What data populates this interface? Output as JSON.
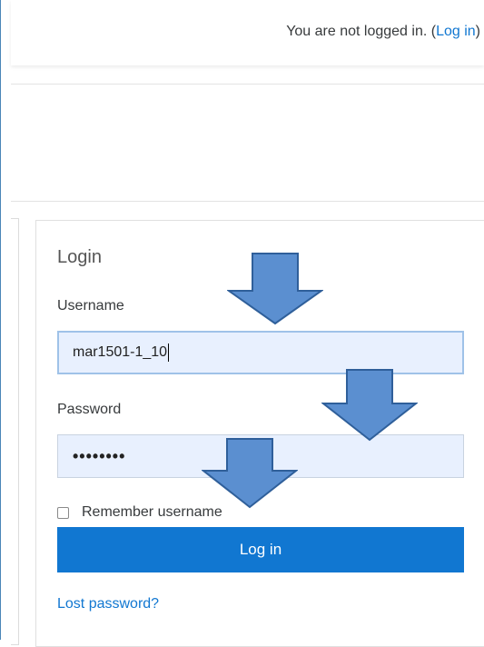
{
  "topbar": {
    "status_prefix": "You are not logged in. (",
    "login_link": "Log in",
    "status_suffix": ")"
  },
  "login": {
    "title": "Login",
    "username_label": "Username",
    "username_value": "mar1501-1_10",
    "password_label": "Password",
    "password_value": "••••••••",
    "remember_label": "Remember username",
    "remember_checked": false,
    "submit_label": "Log in",
    "lost_password_label": "Lost password?"
  },
  "colors": {
    "accent": "#1177d1",
    "input_bg": "#e8f0fe",
    "arrow_fill": "#5b8fd0",
    "arrow_stroke": "#2f5f9a"
  },
  "annotations": {
    "arrow_icon": "down-arrow-icon",
    "count": 3
  }
}
